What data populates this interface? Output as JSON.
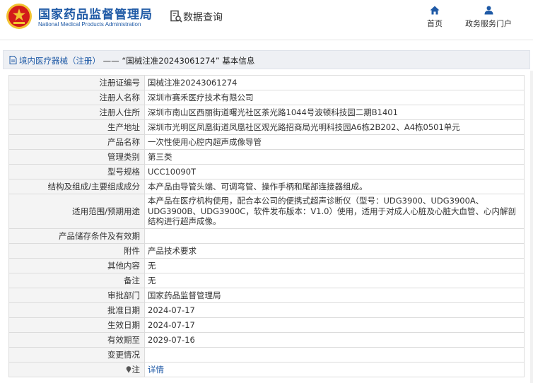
{
  "header": {
    "logo_cn": "国家药品监督管理局",
    "logo_en": "National Medical Products Administration",
    "section_title": "数据查询",
    "nav": [
      {
        "label": "首页",
        "icon": "home-icon"
      },
      {
        "label": "政务服务门户",
        "icon": "user-icon"
      }
    ]
  },
  "breadcrumb": {
    "category": "境内医疗器械（注册）",
    "separator": "——",
    "current": "“国械注准20243061274” 基本信息"
  },
  "colors": {
    "brand_blue": "#1f5aa6",
    "emblem_red": "#d21a1a",
    "emblem_gold": "#f2c230",
    "key_bg": "#f4f4f4"
  },
  "record": [
    {
      "key": "注册证编号",
      "value": "国械注准20243061274"
    },
    {
      "key": "注册人名称",
      "value": "深圳市赛禾医疗技术有限公司"
    },
    {
      "key": "注册人住所",
      "value": "深圳市南山区西丽街道曙光社区茶光路1044号波顿科技园二期B1401"
    },
    {
      "key": "生产地址",
      "value": "深圳市光明区凤凰街道凤凰社区观光路招商局光明科技园A6栋2B202、A4栋0501单元"
    },
    {
      "key": "产品名称",
      "value": "一次性使用心腔内超声成像导管"
    },
    {
      "key": "管理类别",
      "value": "第三类"
    },
    {
      "key": "型号规格",
      "value": "UCC10090T"
    },
    {
      "key": "结构及组成/主要组成成分",
      "value": "本产品由导管头端、可调弯管、操作手柄和尾部连接器组成。"
    },
    {
      "key": "适用范围/预期用途",
      "value": "本产品在医疗机构使用，配合本公司的便携式超声诊断仪（型号：UDG3900、UDG3900A、UDG3900B、UDG3900C，软件发布版本：V1.0）使用，适用于对成人心脏及心脏大血管、心内解剖结构进行超声成像。"
    },
    {
      "key": "产品储存条件及有效期",
      "value": ""
    },
    {
      "key": "附件",
      "value": "产品技术要求"
    },
    {
      "key": "其他内容",
      "value": "无"
    },
    {
      "key": "备注",
      "value": "无"
    },
    {
      "key": "审批部门",
      "value": "国家药品监督管理局"
    },
    {
      "key": "批准日期",
      "value": "2024-07-17"
    },
    {
      "key": "生效日期",
      "value": "2024-07-17"
    },
    {
      "key": "有效期至",
      "value": "2029-07-16"
    },
    {
      "key": "变更情况",
      "value": ""
    },
    {
      "key": "注",
      "value": "详情"
    }
  ]
}
